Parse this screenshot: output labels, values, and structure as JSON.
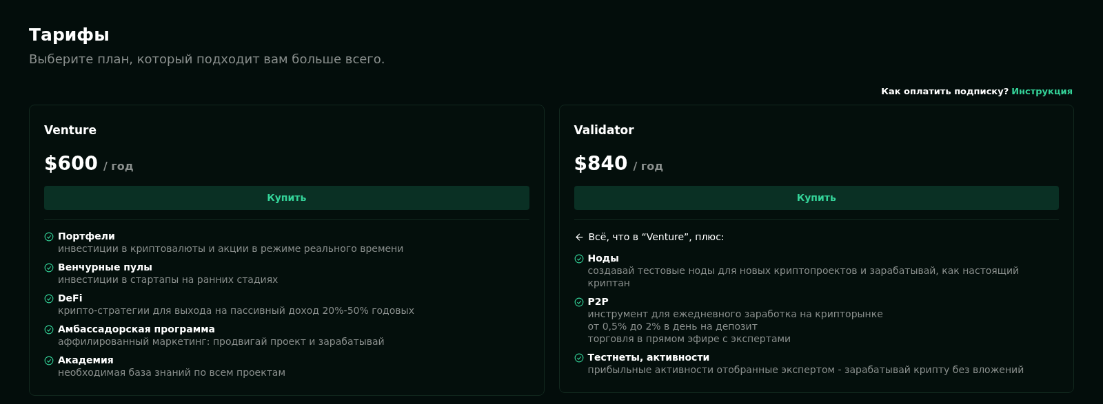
{
  "header": {
    "title": "Тарифы",
    "subtitle": "Выберите план, который подходит вам больше всего."
  },
  "help": {
    "question": "Как оплатить подписку?",
    "link": "Инструкция"
  },
  "plans": [
    {
      "name": "Venture",
      "price": "$600",
      "period": "/ год",
      "button": "Купить",
      "features": [
        {
          "title": "Портфели",
          "lines": [
            "инвестиции в криптовалюты и акции в режиме реального времени"
          ]
        },
        {
          "title": "Венчурные пулы",
          "lines": [
            "инвестиции в стартапы на ранних стадиях"
          ]
        },
        {
          "title": "DeFi",
          "lines": [
            "крипто-стратегии для выхода на пассивный доход 20%-50% годовых"
          ]
        },
        {
          "title": "Амбассадорская программа",
          "lines": [
            "аффилированный маркетинг: продвигай проект и зарабатывай"
          ]
        },
        {
          "title": "Академия",
          "lines": [
            "необходимая база знаний по всем проектам"
          ]
        }
      ]
    },
    {
      "name": "Validator",
      "price": "$840",
      "period": "/ год",
      "button": "Купить",
      "intro": "Всё, что в “Venture”, плюс:",
      "features": [
        {
          "title": "Ноды",
          "lines": [
            "создавай тестовые ноды для новых криптопроектов и зарабатывай, как настоящий криптан"
          ]
        },
        {
          "title": "P2P",
          "lines": [
            "инструмент для ежедневного заработка на крипторынке",
            "от 0,5% до 2% в день на депозит",
            "торговля в прямом эфире с экспертами"
          ]
        },
        {
          "title": "Тестнеты, активности",
          "lines": [
            "прибыльные активности отобранные экспертом - зарабатывай крипту без вложений"
          ]
        }
      ]
    }
  ]
}
